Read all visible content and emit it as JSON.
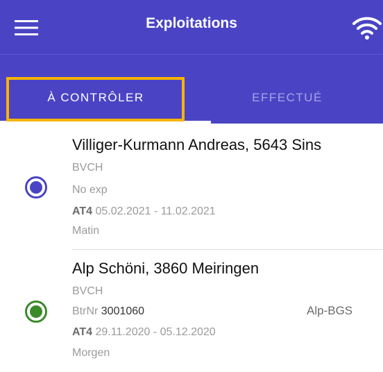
{
  "appbar": {
    "title": "Exploitations",
    "menu_icon": "hamburger-menu-icon",
    "status_icon": "wifi-icon",
    "background": "#4a44c4"
  },
  "tabs": [
    {
      "label": "À CONTRÔLER",
      "selected": true
    },
    {
      "label": "EFFECTUÉ",
      "selected": false
    }
  ],
  "highlight_color": "#f7b400",
  "items": [
    {
      "name": "Villiger-Kurmann Andreas, 5643 Sins",
      "org": "BVCH",
      "exp": "No exp",
      "at_label": "AT4",
      "dates": "05.02.2021 - 11.02.2021",
      "period": "Matin",
      "status_color": "#4a44c4"
    },
    {
      "name": "Alp Schöni, 3860 Meiringen",
      "org": "BVCH",
      "btr_label": "BtrNr",
      "btr_value": "3001060",
      "tag": "Alp-BGS",
      "at_label": "AT4",
      "dates": "29.11.2020 - 05.12.2020",
      "period": "Morgen",
      "status_color": "#3b8a2a"
    }
  ]
}
